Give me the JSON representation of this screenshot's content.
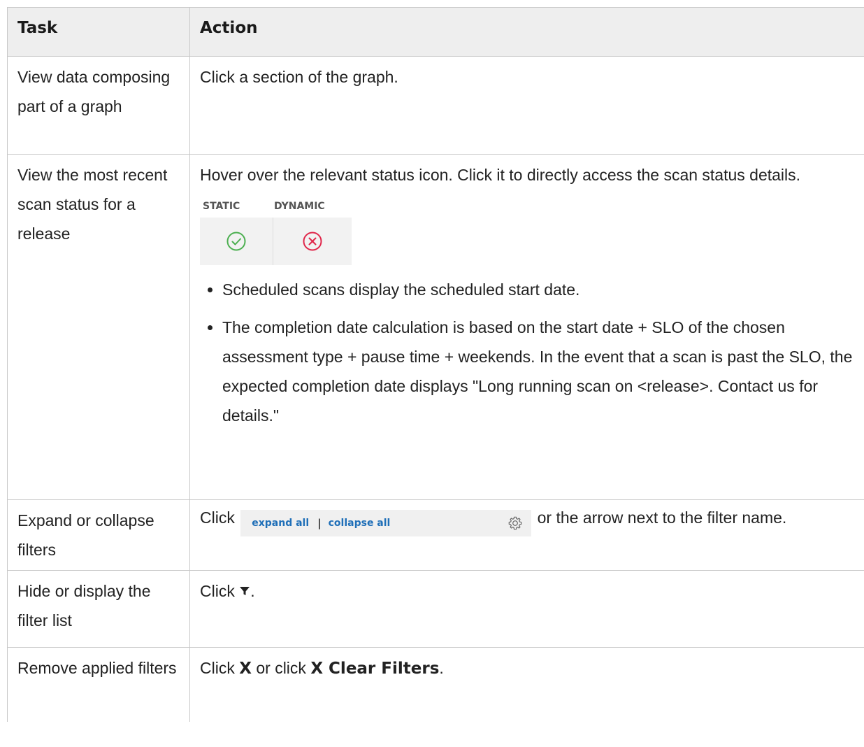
{
  "table": {
    "headers": {
      "task": "Task",
      "action": "Action"
    },
    "rows": [
      {
        "task": "View data composing part of a graph",
        "action": "Click a section of the graph."
      },
      {
        "task": "View the most recent scan status for a release",
        "action": "Hover over the relevant status icon. Click it to directly access the scan status details.",
        "status_figure": {
          "static_label": "STATIC",
          "dynamic_label": "DYNAMIC",
          "static_icon": "check-circle-icon",
          "dynamic_icon": "x-circle-icon",
          "static_color": "#4caf50",
          "dynamic_color": "#e0264a"
        },
        "bullets": [
          "Scheduled scans display the scheduled start date.",
          "The completion date calculation is based on the start date + SLO of the chosen assessment type + pause time + weekends. In the event that a scan is past the SLO, the expected completion date displays \"Long running scan on <release>. Contact us for details.\""
        ]
      },
      {
        "task": "Expand or collapse filters",
        "action_prefix": "Click",
        "expand_all": "expand all",
        "separator": "|",
        "collapse_all": "collapse all",
        "action_suffix": "or the arrow next to the filter name.",
        "link_color": "#1f6fb8",
        "settings_icon": "gear-icon"
      },
      {
        "task": "Hide or display the filter list",
        "action_prefix": "Click",
        "filter_icon": "funnel-icon",
        "action_suffix": "."
      },
      {
        "task": "Remove applied filters",
        "action_prefix": "Click",
        "bold_1": "X",
        "middle": "or click",
        "bold_2": "X Clear Filters",
        "action_suffix": "."
      }
    ]
  }
}
